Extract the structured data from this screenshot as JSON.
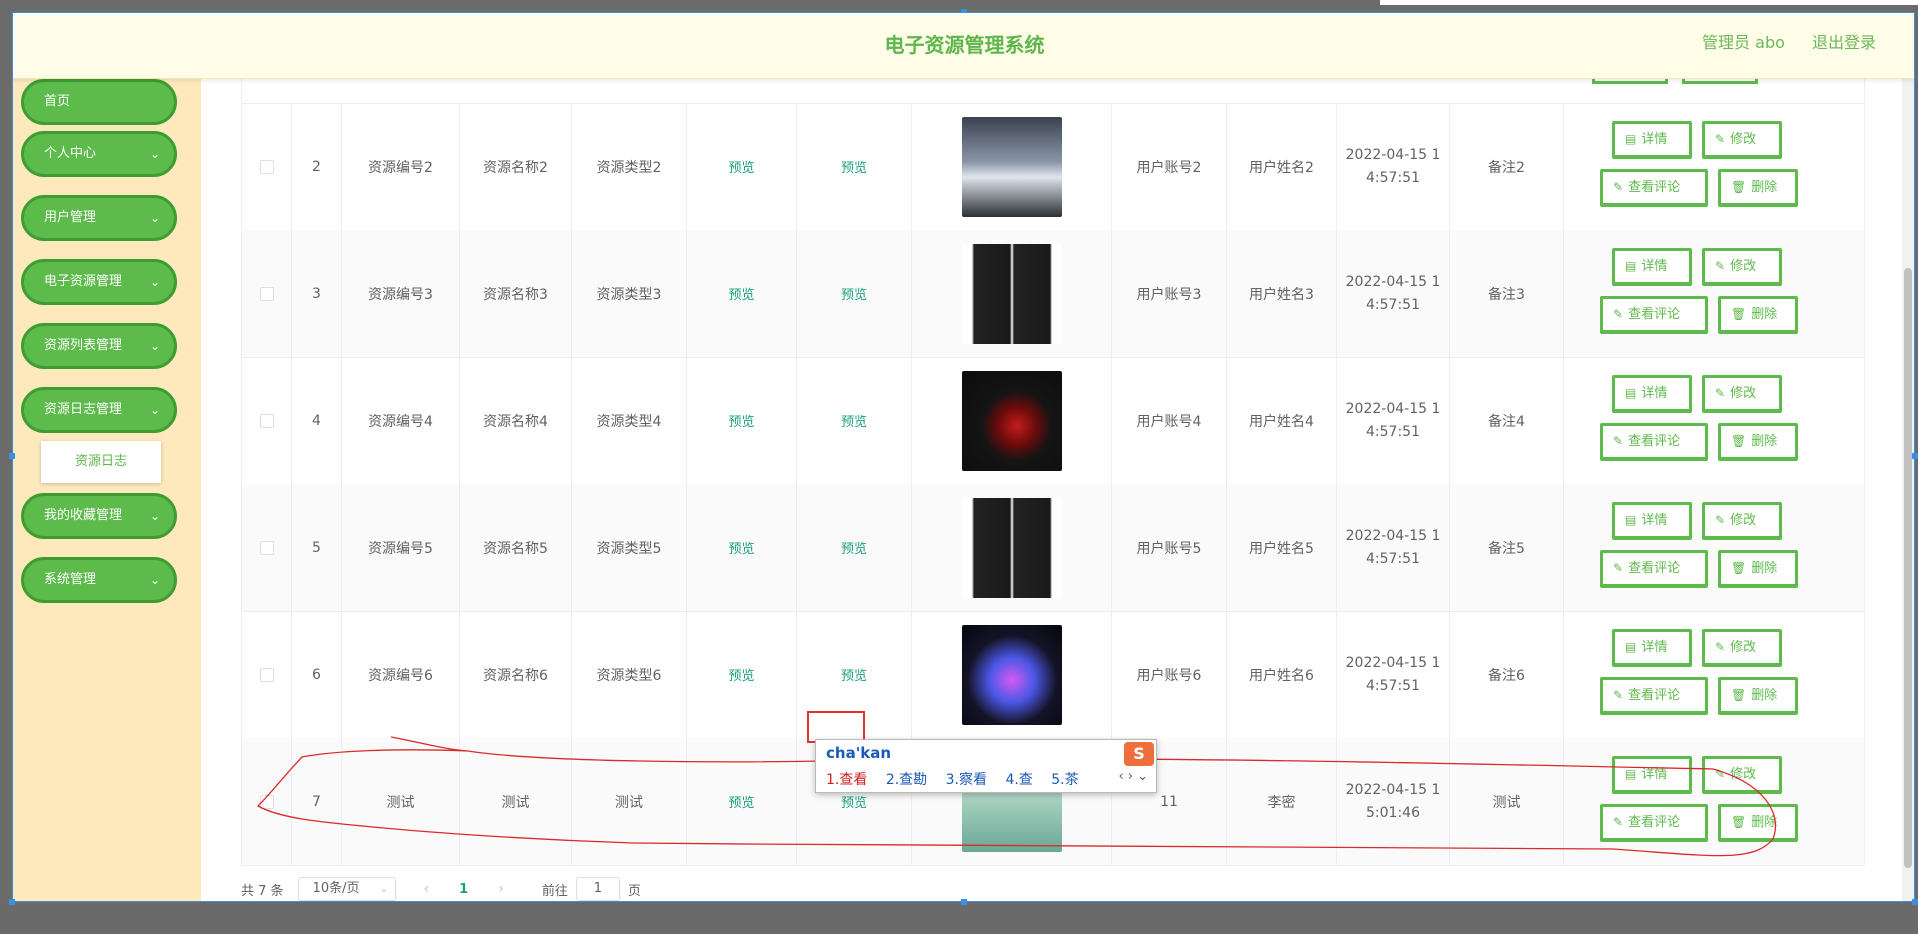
{
  "header": {
    "title": "电子资源管理系统",
    "user": "管理员 abo",
    "logout": "退出登录"
  },
  "sidebar": {
    "items": [
      {
        "label": "首页",
        "chevron": ""
      },
      {
        "label": "个人中心",
        "chevron": "⌄"
      },
      {
        "label": "用户管理",
        "chevron": "⌄"
      },
      {
        "label": "电子资源管理",
        "chevron": "⌄"
      },
      {
        "label": "资源列表管理",
        "chevron": "⌄"
      },
      {
        "label": "资源日志管理",
        "chevron": "⌄"
      },
      {
        "label": "我的收藏管理",
        "chevron": "⌄"
      },
      {
        "label": "系统管理",
        "chevron": "⌄"
      }
    ],
    "submenu": "资源日志"
  },
  "rows": [
    {
      "idx": "2",
      "code": "资源编号2",
      "name": "资源名称2",
      "type": "资源类型2",
      "preview1": "预览",
      "preview2": "预览",
      "account": "用户账号2",
      "username": "用户姓名2",
      "time": "2022-04-15 14:57:51",
      "note": "备注2"
    },
    {
      "idx": "3",
      "code": "资源编号3",
      "name": "资源名称3",
      "type": "资源类型3",
      "preview1": "预览",
      "preview2": "预览",
      "account": "用户账号3",
      "username": "用户姓名3",
      "time": "2022-04-15 14:57:51",
      "note": "备注3"
    },
    {
      "idx": "4",
      "code": "资源编号4",
      "name": "资源名称4",
      "type": "资源类型4",
      "preview1": "预览",
      "preview2": "预览",
      "account": "用户账号4",
      "username": "用户姓名4",
      "time": "2022-04-15 14:57:51",
      "note": "备注4"
    },
    {
      "idx": "5",
      "code": "资源编号5",
      "name": "资源名称5",
      "type": "资源类型5",
      "preview1": "预览",
      "preview2": "预览",
      "account": "用户账号5",
      "username": "用户姓名5",
      "time": "2022-04-15 14:57:51",
      "note": "备注5"
    },
    {
      "idx": "6",
      "code": "资源编号6",
      "name": "资源名称6",
      "type": "资源类型6",
      "preview1": "预览",
      "preview2": "预览",
      "account": "用户账号6",
      "username": "用户姓名6",
      "time": "2022-04-15 14:57:51",
      "note": "备注6"
    },
    {
      "idx": "7",
      "code": "测试",
      "name": "测试",
      "type": "测试",
      "preview1": "预览",
      "preview2": "预览",
      "account": "11",
      "username": "李密",
      "time": "2022-04-15 15:01:46",
      "note": "测试"
    }
  ],
  "ops": {
    "detail": "详情",
    "edit": "修改",
    "comments": "查看评论",
    "delete": "删除"
  },
  "pager": {
    "total": "共 7 条",
    "size": "10条/页",
    "current": "1",
    "goto": "前往",
    "goto_value": "1",
    "page_unit": "页"
  },
  "ime": {
    "pinyin": "cha'kan",
    "candidates": [
      "1.查看",
      "2.查勘",
      "3.察看",
      "4.查",
      "5.茶"
    ],
    "logo": "S"
  },
  "colors": {
    "accent": "#5dbb4c",
    "link": "#1aa07b",
    "header_bg": "#fffde8",
    "sidebar_bg": "#fee9bc"
  }
}
